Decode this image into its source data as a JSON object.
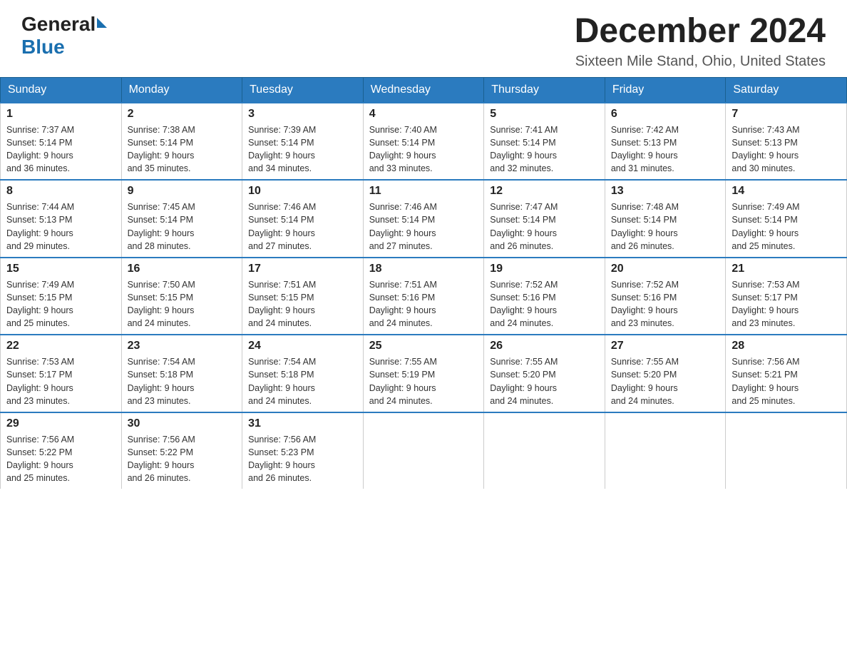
{
  "header": {
    "logo_general": "General",
    "logo_blue": "Blue",
    "month_title": "December 2024",
    "location": "Sixteen Mile Stand, Ohio, United States"
  },
  "days_of_week": [
    "Sunday",
    "Monday",
    "Tuesday",
    "Wednesday",
    "Thursday",
    "Friday",
    "Saturday"
  ],
  "weeks": [
    [
      {
        "day": "1",
        "sunrise": "7:37 AM",
        "sunset": "5:14 PM",
        "daylight": "9 hours and 36 minutes."
      },
      {
        "day": "2",
        "sunrise": "7:38 AM",
        "sunset": "5:14 PM",
        "daylight": "9 hours and 35 minutes."
      },
      {
        "day": "3",
        "sunrise": "7:39 AM",
        "sunset": "5:14 PM",
        "daylight": "9 hours and 34 minutes."
      },
      {
        "day": "4",
        "sunrise": "7:40 AM",
        "sunset": "5:14 PM",
        "daylight": "9 hours and 33 minutes."
      },
      {
        "day": "5",
        "sunrise": "7:41 AM",
        "sunset": "5:14 PM",
        "daylight": "9 hours and 32 minutes."
      },
      {
        "day": "6",
        "sunrise": "7:42 AM",
        "sunset": "5:13 PM",
        "daylight": "9 hours and 31 minutes."
      },
      {
        "day": "7",
        "sunrise": "7:43 AM",
        "sunset": "5:13 PM",
        "daylight": "9 hours and 30 minutes."
      }
    ],
    [
      {
        "day": "8",
        "sunrise": "7:44 AM",
        "sunset": "5:13 PM",
        "daylight": "9 hours and 29 minutes."
      },
      {
        "day": "9",
        "sunrise": "7:45 AM",
        "sunset": "5:14 PM",
        "daylight": "9 hours and 28 minutes."
      },
      {
        "day": "10",
        "sunrise": "7:46 AM",
        "sunset": "5:14 PM",
        "daylight": "9 hours and 27 minutes."
      },
      {
        "day": "11",
        "sunrise": "7:46 AM",
        "sunset": "5:14 PM",
        "daylight": "9 hours and 27 minutes."
      },
      {
        "day": "12",
        "sunrise": "7:47 AM",
        "sunset": "5:14 PM",
        "daylight": "9 hours and 26 minutes."
      },
      {
        "day": "13",
        "sunrise": "7:48 AM",
        "sunset": "5:14 PM",
        "daylight": "9 hours and 26 minutes."
      },
      {
        "day": "14",
        "sunrise": "7:49 AM",
        "sunset": "5:14 PM",
        "daylight": "9 hours and 25 minutes."
      }
    ],
    [
      {
        "day": "15",
        "sunrise": "7:49 AM",
        "sunset": "5:15 PM",
        "daylight": "9 hours and 25 minutes."
      },
      {
        "day": "16",
        "sunrise": "7:50 AM",
        "sunset": "5:15 PM",
        "daylight": "9 hours and 24 minutes."
      },
      {
        "day": "17",
        "sunrise": "7:51 AM",
        "sunset": "5:15 PM",
        "daylight": "9 hours and 24 minutes."
      },
      {
        "day": "18",
        "sunrise": "7:51 AM",
        "sunset": "5:16 PM",
        "daylight": "9 hours and 24 minutes."
      },
      {
        "day": "19",
        "sunrise": "7:52 AM",
        "sunset": "5:16 PM",
        "daylight": "9 hours and 24 minutes."
      },
      {
        "day": "20",
        "sunrise": "7:52 AM",
        "sunset": "5:16 PM",
        "daylight": "9 hours and 23 minutes."
      },
      {
        "day": "21",
        "sunrise": "7:53 AM",
        "sunset": "5:17 PM",
        "daylight": "9 hours and 23 minutes."
      }
    ],
    [
      {
        "day": "22",
        "sunrise": "7:53 AM",
        "sunset": "5:17 PM",
        "daylight": "9 hours and 23 minutes."
      },
      {
        "day": "23",
        "sunrise": "7:54 AM",
        "sunset": "5:18 PM",
        "daylight": "9 hours and 23 minutes."
      },
      {
        "day": "24",
        "sunrise": "7:54 AM",
        "sunset": "5:18 PM",
        "daylight": "9 hours and 24 minutes."
      },
      {
        "day": "25",
        "sunrise": "7:55 AM",
        "sunset": "5:19 PM",
        "daylight": "9 hours and 24 minutes."
      },
      {
        "day": "26",
        "sunrise": "7:55 AM",
        "sunset": "5:20 PM",
        "daylight": "9 hours and 24 minutes."
      },
      {
        "day": "27",
        "sunrise": "7:55 AM",
        "sunset": "5:20 PM",
        "daylight": "9 hours and 24 minutes."
      },
      {
        "day": "28",
        "sunrise": "7:56 AM",
        "sunset": "5:21 PM",
        "daylight": "9 hours and 25 minutes."
      }
    ],
    [
      {
        "day": "29",
        "sunrise": "7:56 AM",
        "sunset": "5:22 PM",
        "daylight": "9 hours and 25 minutes."
      },
      {
        "day": "30",
        "sunrise": "7:56 AM",
        "sunset": "5:22 PM",
        "daylight": "9 hours and 26 minutes."
      },
      {
        "day": "31",
        "sunrise": "7:56 AM",
        "sunset": "5:23 PM",
        "daylight": "9 hours and 26 minutes."
      },
      null,
      null,
      null,
      null
    ]
  ]
}
